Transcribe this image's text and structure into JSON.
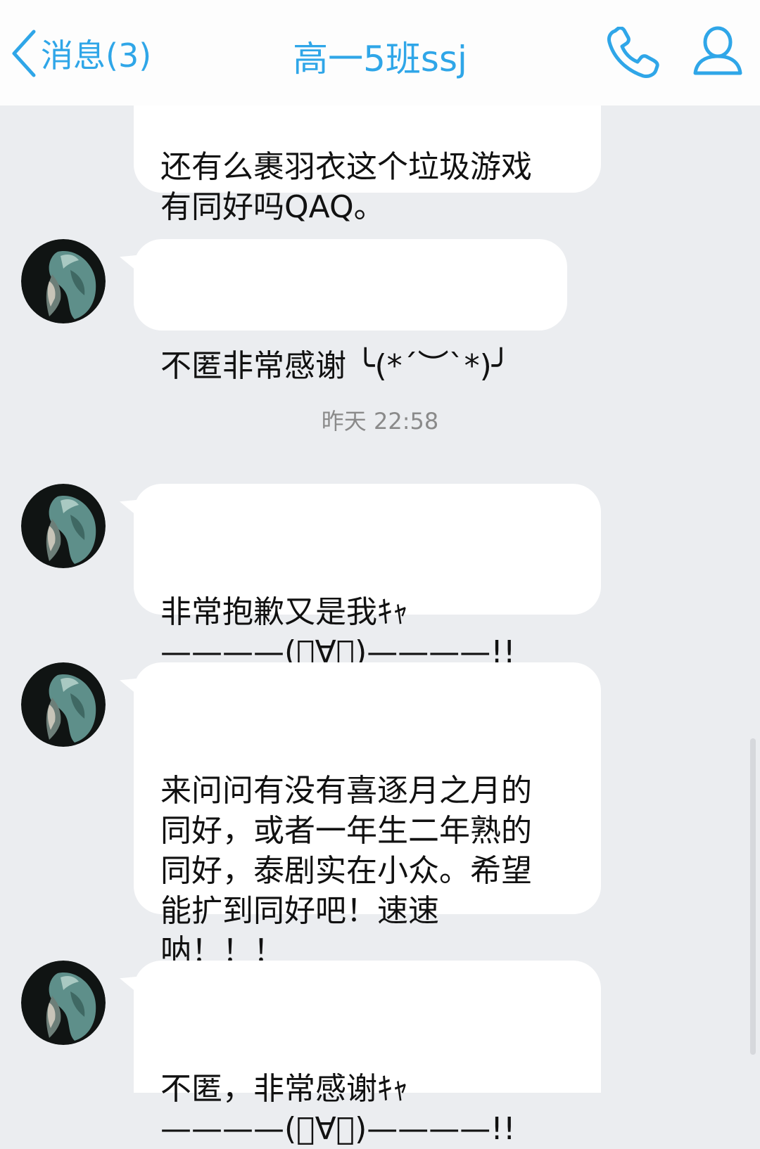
{
  "header": {
    "back_label": "消息(3)",
    "title": "高一5班ssj"
  },
  "colors": {
    "accent": "#2fa6e8",
    "background": "#ebedf0",
    "bubble": "#ffffff"
  },
  "icons": {
    "back": "chevron-left-icon",
    "call": "phone-icon",
    "profile": "person-icon"
  },
  "messages": [
    {
      "text": "还有么裹羽衣这个垃圾游戏\n有同好吗QAQ。"
    },
    {
      "text": "不匿非常感谢 ╰(*´︶`*)╯"
    },
    {
      "text": "非常抱歉又是我ｷｬ\n————(ﾟ∀ﾟ)————!!"
    },
    {
      "text": "来问问有没有喜逐月之月的\n同好，或者一年生二年熟的\n同好，泰剧实在小众。希望\n能扩到同好吧！速速\n呐！！！"
    },
    {
      "text": "不匿，非常感谢ｷｬ\n————(ﾟ∀ﾟ)————!!"
    }
  ],
  "timestamp": "昨天 22:58"
}
